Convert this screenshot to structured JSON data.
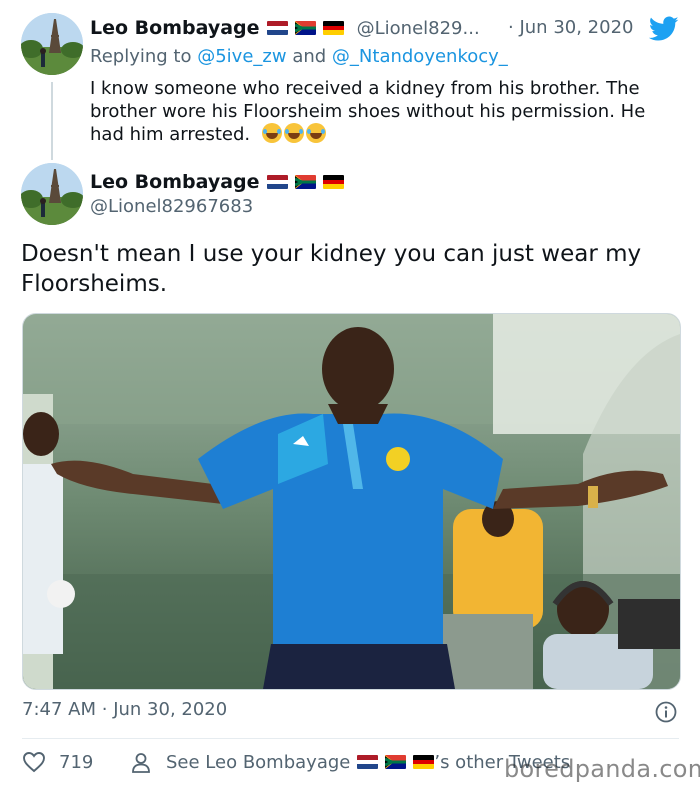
{
  "parent_tweet": {
    "author_name": "Leo Bombayage",
    "handle": "@Lionel829...",
    "separator": "·",
    "date": "Jun 30, 2020",
    "replying_prefix": "Replying to",
    "reply_to_1": "@5ive_zw",
    "reply_joiner": "and",
    "reply_to_2": "@_Ntandoyenkocy_",
    "text": "I know someone who received a kidney from his brother. The brother wore his Floorsheim shoes without his permission. He had him arrested."
  },
  "main_tweet": {
    "author_name": "Leo Bombayage",
    "handle": "@Lionel82967683",
    "text": "Doesn't mean I use your kidney you can just wear my Floorsheims.",
    "time": "7:47 AM",
    "separator": "·",
    "date": "Jun 30, 2020"
  },
  "actions": {
    "like_count": "719",
    "see_prefix": "See Leo Bombayage",
    "see_suffix": "’s other Tweets"
  },
  "watermark": "boredpanda.com",
  "icons": {
    "brand": "twitter-bird-icon",
    "info": "info-icon",
    "like": "heart-icon",
    "profile": "person-icon",
    "emoji": "tears-of-joy-emoji"
  },
  "colors": {
    "twitter_blue": "#1da1f2",
    "link": "#1b95e0",
    "muted_text": "#536471"
  }
}
